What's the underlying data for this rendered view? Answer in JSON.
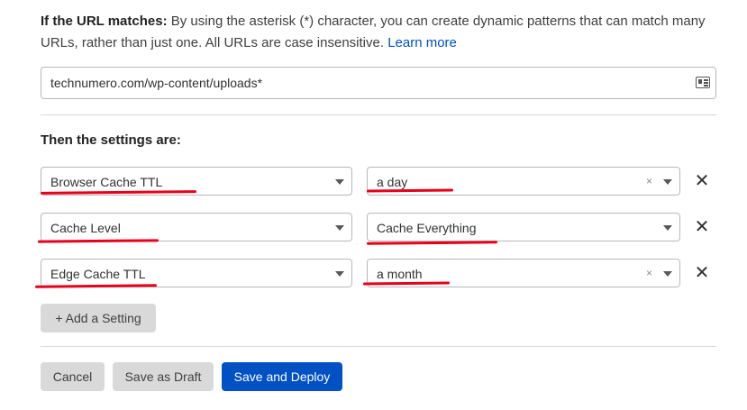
{
  "url_section": {
    "heading": "If the URL matches:",
    "description": " By using the asterisk (*) character, you can create dynamic patterns that can match many URLs, rather than just one. All URLs are case insensitive. ",
    "learn_more": "Learn more",
    "url_value": "technumero.com/wp-content/uploads*"
  },
  "settings_section": {
    "heading": "Then the settings are:",
    "rows": [
      {
        "setting": "Browser Cache TTL",
        "value": "a day",
        "clearable": true
      },
      {
        "setting": "Cache Level",
        "value": "Cache Everything",
        "clearable": false
      },
      {
        "setting": "Edge Cache TTL",
        "value": "a month",
        "clearable": true
      }
    ],
    "clear_glyph": "×",
    "remove_glyph": "✕",
    "add_label": "+ Add a Setting"
  },
  "footer": {
    "cancel": "Cancel",
    "save_draft": "Save as Draft",
    "save_deploy": "Save and Deploy"
  },
  "colors": {
    "primary_button": "#0051c3",
    "link": "#0051c3",
    "annotation_underline": "#e8001c"
  }
}
